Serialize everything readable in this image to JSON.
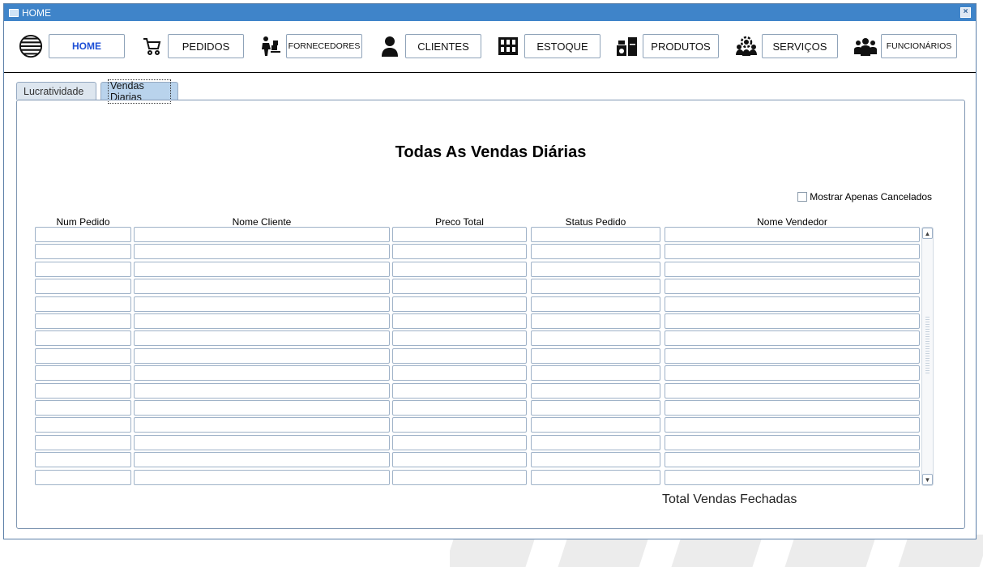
{
  "window": {
    "title": "HOME",
    "close_icon": "close-icon"
  },
  "nav": {
    "items": [
      {
        "label": "HOME",
        "icon": "globe-icon"
      },
      {
        "label": "PEDIDOS",
        "icon": "cart-icon"
      },
      {
        "label": "FORNECEDORES",
        "icon": "delivery-worker-icon"
      },
      {
        "label": "CLIENTES",
        "icon": "person-icon"
      },
      {
        "label": "ESTOQUE",
        "icon": "warehouse-icon"
      },
      {
        "label": "PRODUTOS",
        "icon": "appliances-icon"
      },
      {
        "label": "SERVIÇOS",
        "icon": "service-group-icon"
      },
      {
        "label": "FUNCIONÁRIOS",
        "icon": "employees-icon"
      }
    ],
    "active_label_color": "#1d4fd6"
  },
  "tabs": [
    {
      "label": "Lucratividade"
    },
    {
      "label": "Vendas Diarias"
    }
  ],
  "panel": {
    "title": "Todas As Vendas Diárias",
    "filter_label": "Mostrar Apenas Cancelados",
    "total_label": "Total Vendas Fechadas"
  },
  "table": {
    "columns": [
      "Num Pedido",
      "Nome Cliente",
      "Preco Total",
      "Status Pedido",
      "Nome Vendedor"
    ],
    "row_count": 15
  },
  "colors": {
    "titlebar": "#3f84c9",
    "active_tab": "#b9d3ec"
  }
}
